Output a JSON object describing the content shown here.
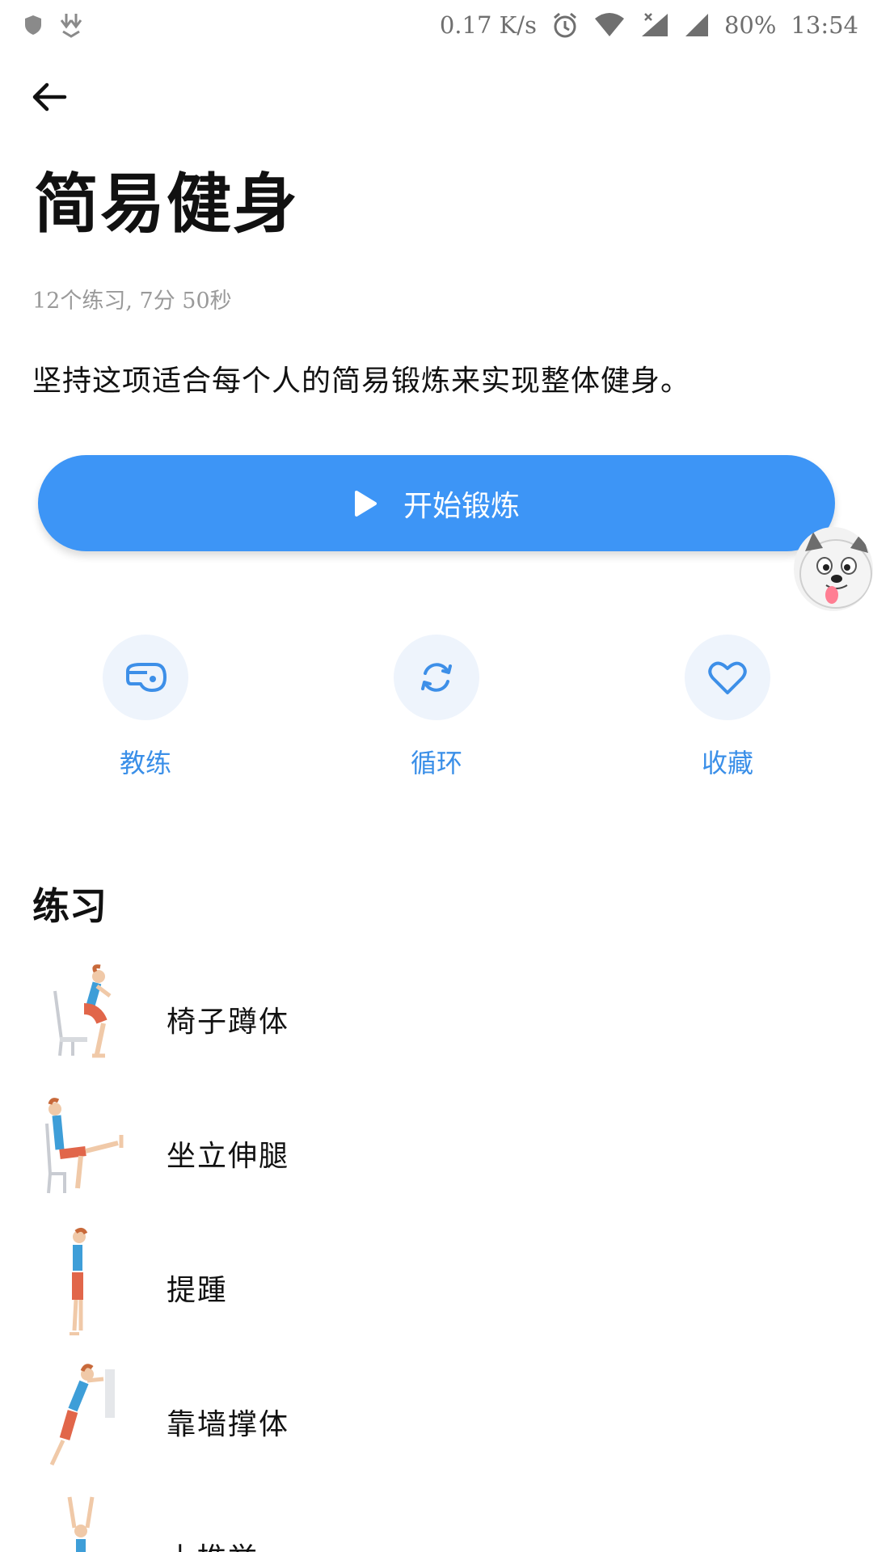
{
  "status_bar": {
    "net_speed": "0.17 K/s",
    "battery": "80%",
    "time": "13:54"
  },
  "header": {
    "title": "简易健身",
    "subtitle": "12个练习, 7分 50秒",
    "description": "坚持这项适合每个人的简易锻炼来实现整体健身。"
  },
  "start_button": {
    "label": "开始锻炼"
  },
  "actions": [
    {
      "label": "教练",
      "icon": "whistle-icon"
    },
    {
      "label": "循环",
      "icon": "repeat-icon"
    },
    {
      "label": "收藏",
      "icon": "heart-icon"
    }
  ],
  "section": {
    "title": "练习"
  },
  "exercises": [
    {
      "name": "椅子蹲体"
    },
    {
      "name": "坐立伸腿"
    },
    {
      "name": "提踵"
    },
    {
      "name": "靠墙撑体"
    },
    {
      "name": "上推举"
    }
  ],
  "colors": {
    "accent": "#3d95f6",
    "accent_text": "#3a8fe8",
    "circle_bg": "#eef4fc"
  }
}
